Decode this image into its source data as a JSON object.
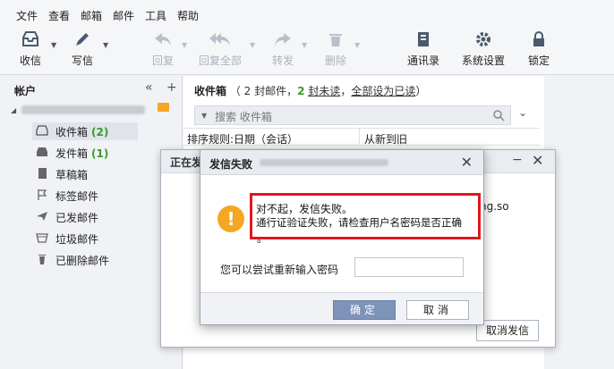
{
  "menu": [
    "文件",
    "查看",
    "邮箱",
    "邮件",
    "工具",
    "帮助"
  ],
  "toolbar": {
    "receive": "收信",
    "compose": "写信",
    "reply": "回复",
    "reply_all": "回复全部",
    "forward": "转发",
    "delete": "删除",
    "contacts": "通讯录",
    "settings": "系统设置",
    "lock": "锁定"
  },
  "sidebar": {
    "title": "帐户",
    "collapse": "«",
    "add": "+",
    "folders": [
      {
        "label": "收件箱",
        "count": "(2)"
      },
      {
        "label": "发件箱",
        "count": "(1)"
      },
      {
        "label": "草稿箱",
        "count": ""
      },
      {
        "label": "标签邮件",
        "count": ""
      },
      {
        "label": "已发邮件",
        "count": ""
      },
      {
        "label": "垃圾邮件",
        "count": ""
      },
      {
        "label": "已删除邮件",
        "count": ""
      }
    ]
  },
  "main": {
    "title": "收件箱",
    "count_prefix": "（ 2 封邮件，",
    "unread_num": "2",
    "unread_label": "封未读",
    "sep": "，",
    "mark_read": "全部设为已读",
    "close_paren": "）",
    "search_placeholder": "搜索 收件箱",
    "sort_rule": "排序规则:日期（会话）",
    "sort_order": "从新到旧"
  },
  "bg_dialog": {
    "title": "正在发",
    "peek_text": "ng.so",
    "cancel_send": "取消发信"
  },
  "dialog": {
    "title": "发信失败",
    "line1": "对不起，发信失败。",
    "line2": "通行证验证失败，请检查用户名密码是否正确",
    "line3": "。",
    "retry_label": "您可以尝试重新输入密码",
    "password_value": "",
    "ok": "确定",
    "cancel": "取消"
  }
}
